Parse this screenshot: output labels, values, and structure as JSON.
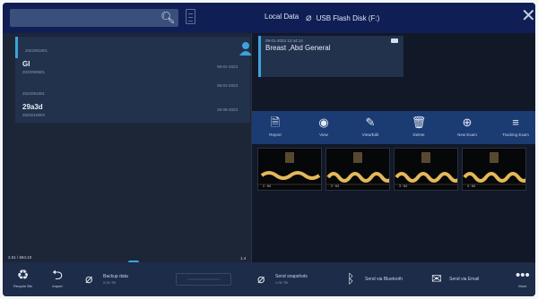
{
  "header": {
    "search": {
      "value": "",
      "placeholder": ""
    },
    "title": "Local Data",
    "server": "USB Flash Disk (F:)",
    "icons": [
      "search-icon",
      "list-view-icon",
      "usb-link-icon",
      "close-icon"
    ]
  },
  "patients": [
    {
      "id": "2022091801",
      "name": "",
      "date": "",
      "selected": true
    },
    {
      "id": "2022090801",
      "name": "GI",
      "date": "09-01-2023",
      "selected": false
    },
    {
      "id": "2022091801",
      "name": "",
      "date": "08-01-2023",
      "selected": false
    },
    {
      "id": "2022016802",
      "name": "29a3d",
      "date": "28-08-2023",
      "selected": false
    }
  ],
  "storage": {
    "text": "2.61 / 684.10",
    "fill": 0.8,
    "right": "1.4"
  },
  "study": {
    "date": "09-01-2023 12:44:14",
    "title": "Breast ,Abd General",
    "icon": "video-camera-icon"
  },
  "toolbar": [
    {
      "label": "Report",
      "icon": "report-icon"
    },
    {
      "label": "View",
      "icon": "eye-icon"
    },
    {
      "label": "View/Edit",
      "icon": "pencil-icon"
    },
    {
      "label": "Delete",
      "icon": "trash-icon"
    },
    {
      "label": "New Exam",
      "icon": "add-circle-icon"
    },
    {
      "label": "Tracking Exam",
      "icon": "tracking-icon"
    }
  ],
  "thumbnails": [
    {
      "label": "1 · 64"
    },
    {
      "label": "2 · 64"
    },
    {
      "label": "3 · 64"
    },
    {
      "label": "4 · 64"
    }
  ],
  "bottom": {
    "recycle": "Recycle Bin",
    "import": "Import",
    "backup": {
      "label": "Backup data",
      "sub": "0.00 TB"
    },
    "snapshots": {
      "label": "Send snapshots",
      "sub": "1.00 TB"
    },
    "bluetooth": "Send via Bluetooth",
    "email": "Send via Email",
    "more": "More"
  }
}
